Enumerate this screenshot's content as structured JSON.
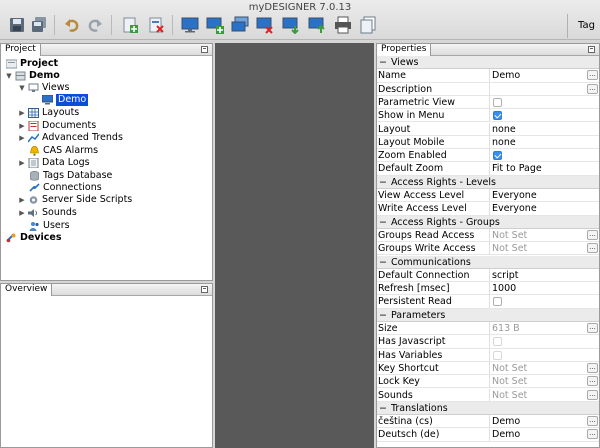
{
  "window": {
    "title": "myDESIGNER 7.0.13"
  },
  "toolbar": {
    "tag_label": "Tag"
  },
  "project_panel": {
    "tab_label": "Project",
    "tree": [
      {
        "label": "Project",
        "bold": true
      },
      {
        "label": "Demo",
        "bold": true
      },
      {
        "label": "Views"
      },
      {
        "label": "Demo",
        "selected": true
      },
      {
        "label": "Layouts"
      },
      {
        "label": "Documents"
      },
      {
        "label": "Advanced Trends"
      },
      {
        "label": "CAS Alarms"
      },
      {
        "label": "Data Logs"
      },
      {
        "label": "Tags Database"
      },
      {
        "label": "Connections"
      },
      {
        "label": "Server Side Scripts"
      },
      {
        "label": "Sounds"
      },
      {
        "label": "Users"
      },
      {
        "label": "Devices",
        "bold": true
      }
    ]
  },
  "overview_panel": {
    "tab_label": "Overview"
  },
  "properties_panel": {
    "tab_label": "Properties",
    "rows": [
      {
        "type": "section",
        "label": "Views"
      },
      {
        "name": "Name",
        "value": "Demo",
        "button": true
      },
      {
        "name": "Description",
        "value": "",
        "button": true
      },
      {
        "name": "Parametric View",
        "check": false
      },
      {
        "name": "Show in Menu",
        "check": true
      },
      {
        "name": "Layout",
        "value": "none"
      },
      {
        "name": "Layout Mobile",
        "value": "none"
      },
      {
        "name": "Zoom Enabled",
        "check": true
      },
      {
        "name": "Default Zoom",
        "value": "Fit to Page"
      },
      {
        "type": "section",
        "label": "Access Rights - Levels"
      },
      {
        "name": "View Access Level",
        "value": "Everyone"
      },
      {
        "name": "Write Access Level",
        "value": "Everyone"
      },
      {
        "type": "section",
        "label": "Access Rights - Groups"
      },
      {
        "name": "Groups Read Access",
        "value": "Not Set",
        "grey": true,
        "button": true
      },
      {
        "name": "Groups Write Access",
        "value": "Not Set",
        "grey": true,
        "button": true
      },
      {
        "type": "section",
        "label": "Communications"
      },
      {
        "name": "Default Connection",
        "value": "script"
      },
      {
        "name": "Refresh [msec]",
        "value": "1000"
      },
      {
        "name": "Persistent Read",
        "check": false
      },
      {
        "type": "section",
        "label": "Parameters"
      },
      {
        "name": "Size",
        "value": "613 B",
        "grey": true,
        "button": true
      },
      {
        "name": "Has Javascript",
        "check": false,
        "disabled": true
      },
      {
        "name": "Has Variables",
        "check": false,
        "disabled": true
      },
      {
        "name": "Key Shortcut",
        "value": "Not Set",
        "grey": true,
        "button": true
      },
      {
        "name": "Lock Key",
        "value": "Not Set",
        "grey": true,
        "button": true
      },
      {
        "name": "Sounds",
        "value": "Not Set",
        "grey": true,
        "button": true
      },
      {
        "type": "section",
        "label": "Translations"
      },
      {
        "name": "čeština (cs)",
        "value": "Demo",
        "button": true
      },
      {
        "name": "Deutsch (de)",
        "value": "Demo",
        "button": true
      }
    ]
  },
  "colors": {
    "selection": "#0b4dd8",
    "checkbox_on": "#3a8ef0",
    "canvas": "#595959"
  }
}
